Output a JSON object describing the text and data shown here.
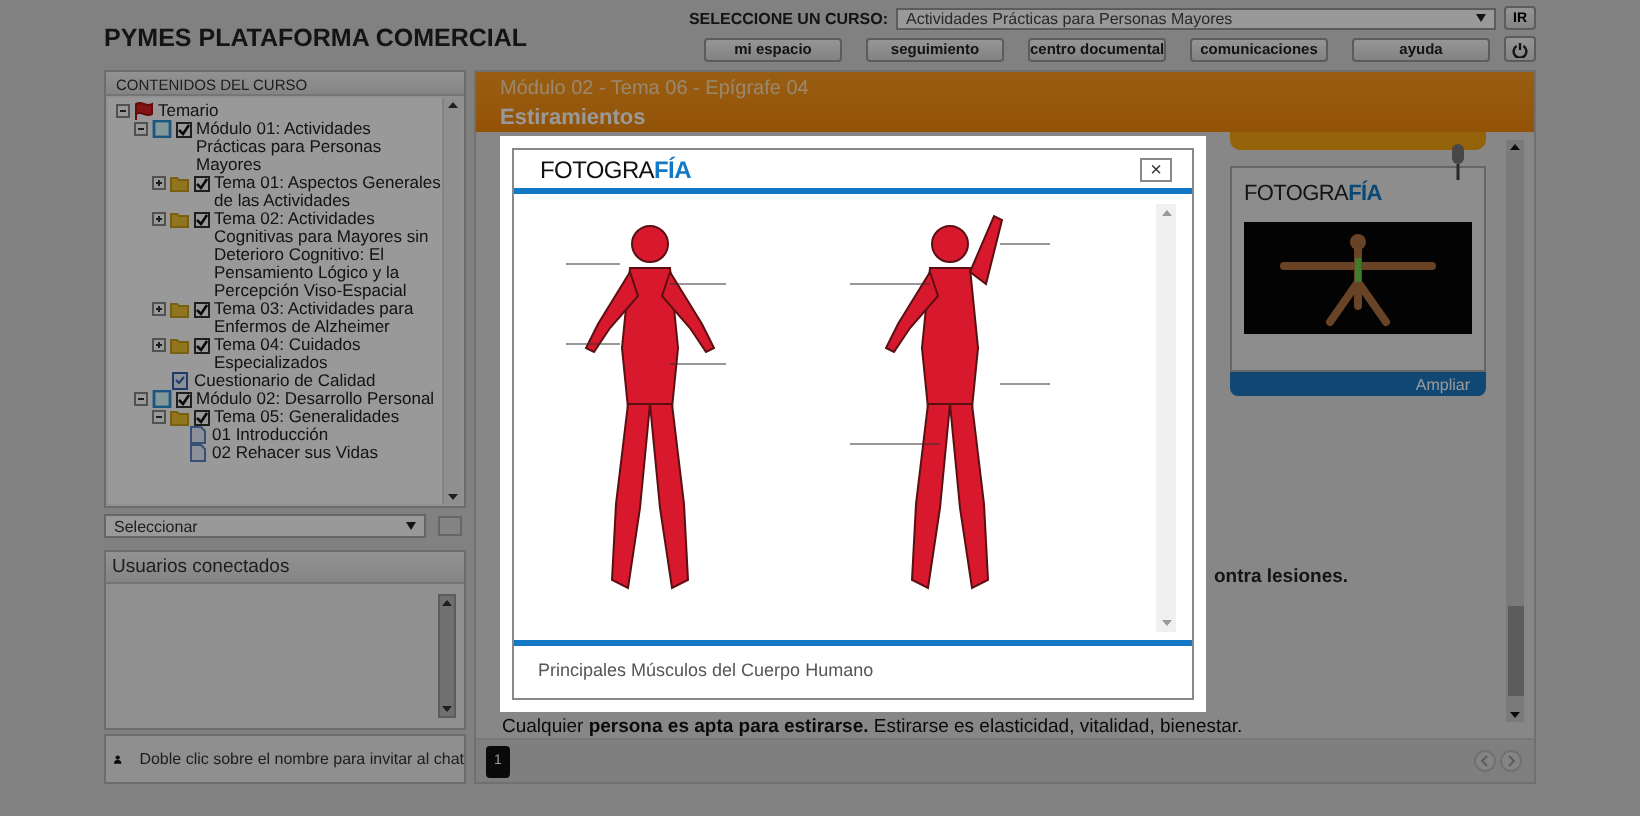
{
  "header": {
    "title": "PYMES PLATAFORMA COMERCIAL",
    "course_label": "SELECCIONE UN CURSO:",
    "course_value": "Actividades Prácticas para Personas Mayores",
    "go_button": "IR",
    "nav": [
      "mi espacio",
      "seguimiento",
      "centro documental",
      "comunicaciones",
      "ayuda"
    ]
  },
  "sidebar": {
    "title": "CONTENIDOS DEL CURSO",
    "select_value": "Seleccionar",
    "tree": [
      {
        "kind": "root",
        "label": "Temario",
        "expanded": true,
        "children": [
          {
            "kind": "module",
            "label": "Módulo 01: Actividades Prácticas para Personas Mayores",
            "checked": true,
            "expanded": true,
            "children": [
              {
                "kind": "topic",
                "label": "Tema 01: Aspectos Generales de las Actividades",
                "checked": true,
                "expanded": false
              },
              {
                "kind": "topic",
                "label": "Tema 02: Actividades Cognitivas para Mayores sin Deterioro Cognitivo: El Pensamiento Lógico y la Percepción Viso-Espacial",
                "checked": true,
                "expanded": false
              },
              {
                "kind": "topic",
                "label": "Tema 03: Actividades para Enfermos de Alzheimer",
                "checked": true,
                "expanded": false
              },
              {
                "kind": "topic",
                "label": "Tema 04: Cuidados Especializados",
                "checked": true,
                "expanded": false
              },
              {
                "kind": "quiz",
                "label": "Cuestionario de Calidad"
              }
            ]
          },
          {
            "kind": "module",
            "label": "Módulo 02: Desarrollo Personal",
            "checked": true,
            "expanded": true,
            "children": [
              {
                "kind": "topic",
                "label": "Tema 05: Generalidades",
                "checked": true,
                "expanded": true,
                "children": [
                  {
                    "kind": "document",
                    "label": "01 Introducción"
                  },
                  {
                    "kind": "document",
                    "label": "02 Rehacer sus Vidas"
                  }
                ]
              }
            ]
          }
        ]
      }
    ]
  },
  "users": {
    "title": "Usuarios conectados",
    "hint": "Doble clic sobre el nombre para invitar al chat"
  },
  "lesson": {
    "breadcrumb": "Módulo 02 - Tema 06 - Epígrafe 04",
    "title": "Estiramientos",
    "partial_text": "ontra lesiones.",
    "paragraph": "Cualquier **persona es apta para estirarse.** Estirarse es elasticidad, vitalidad, bienestar.",
    "widget": {
      "logo": "FOTOGRA",
      "logo_accent": "FÍA",
      "button": "Ampliar"
    },
    "pages": [
      {
        "label": "1",
        "selected": true
      }
    ]
  },
  "modal": {
    "logo": "FOTOGRA",
    "logo_accent": "FÍA",
    "close": "×",
    "caption": "Principales Músculos del Cuerpo Humano"
  }
}
